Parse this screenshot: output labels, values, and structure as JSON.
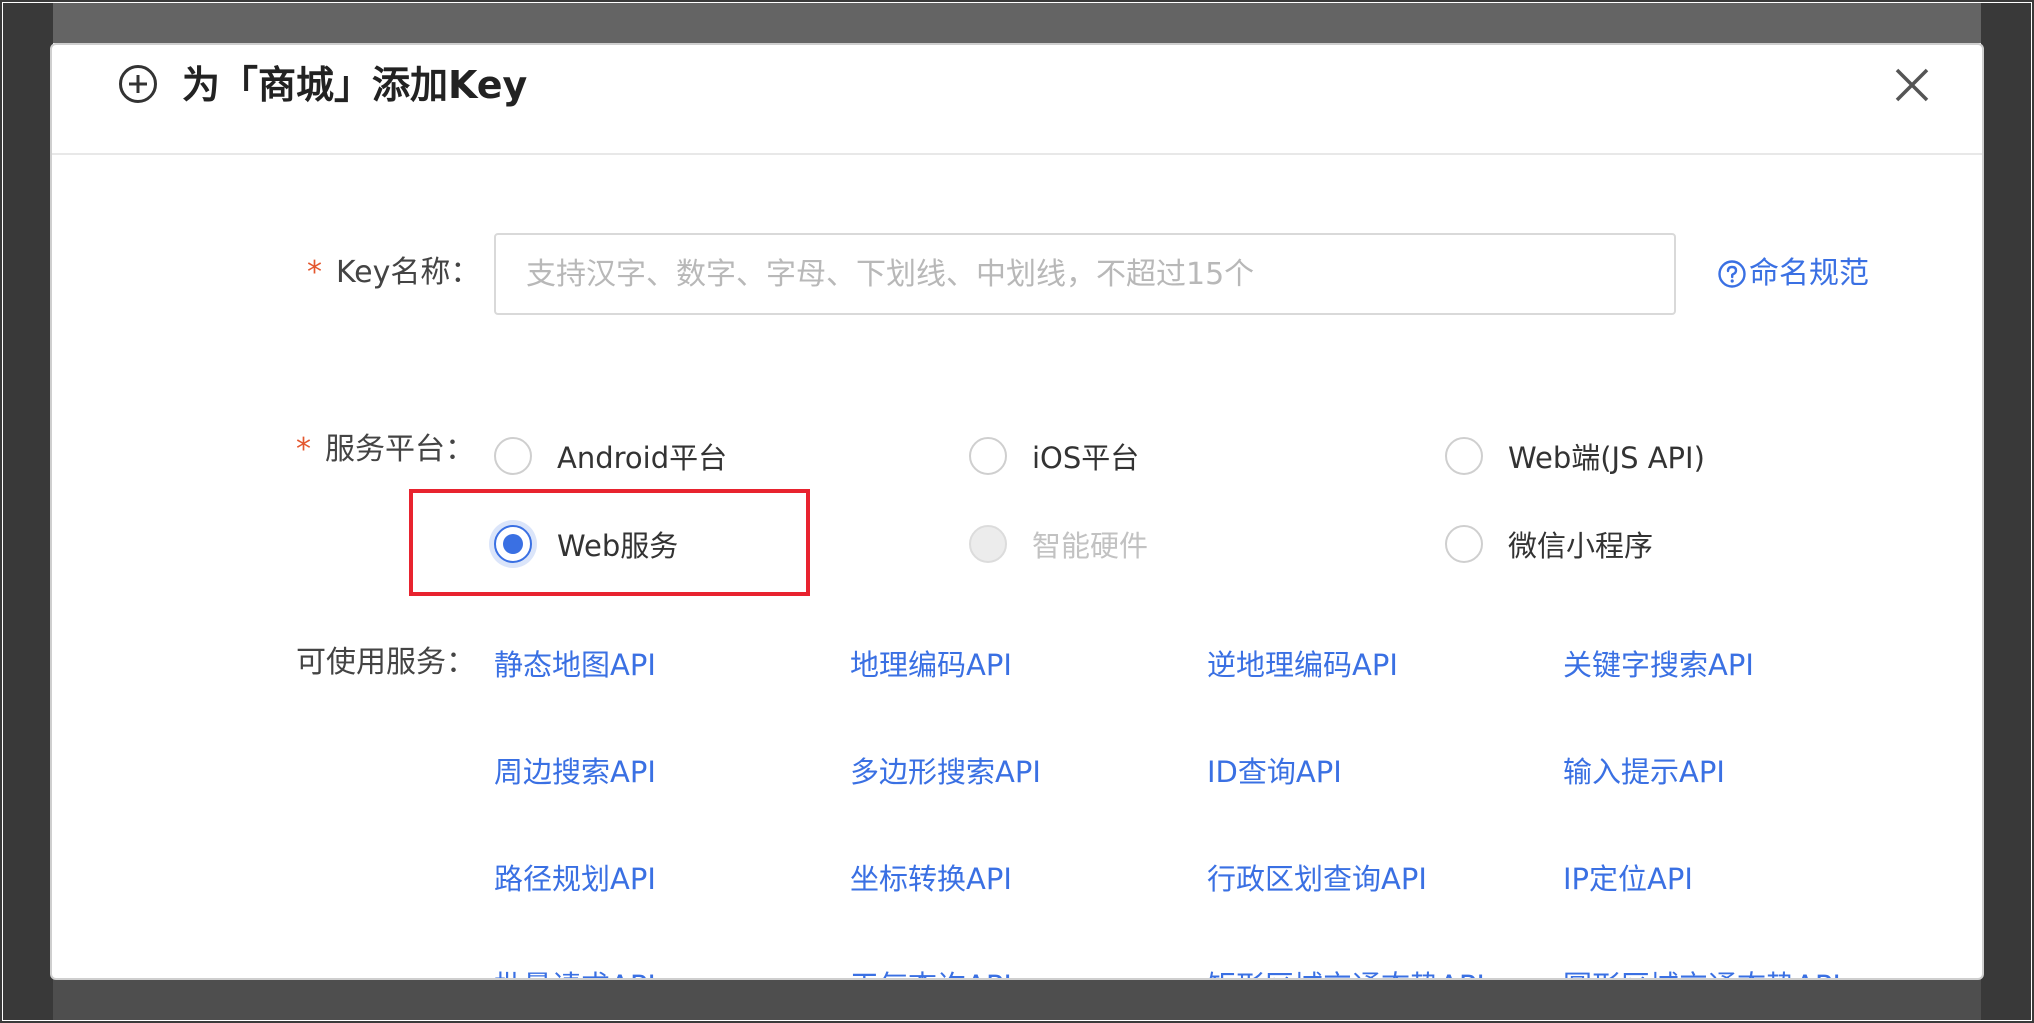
{
  "dialog": {
    "title": "为「商城」添加Key"
  },
  "form": {
    "key_name": {
      "label": "Key名称：",
      "required_mark": "*",
      "placeholder": "支持汉字、数字、字母、下划线、中划线，不超过15个",
      "value": ""
    },
    "help_link": "命名规范",
    "platform": {
      "label": "服务平台：",
      "required_mark": "*",
      "options": [
        {
          "label": "Android平台",
          "checked": false,
          "disabled": false
        },
        {
          "label": "iOS平台",
          "checked": false,
          "disabled": false
        },
        {
          "label": "Web端(JS API)",
          "checked": false,
          "disabled": false
        },
        {
          "label": "Web服务",
          "checked": true,
          "disabled": false
        },
        {
          "label": "智能硬件",
          "checked": false,
          "disabled": true
        },
        {
          "label": "微信小程序",
          "checked": false,
          "disabled": false
        }
      ]
    },
    "services": {
      "label": "可使用服务：",
      "items": [
        "静态地图API",
        "地理编码API",
        "逆地理编码API",
        "关键字搜索API",
        "周边搜索API",
        "多边形搜索API",
        "ID查询API",
        "输入提示API",
        "路径规划API",
        "坐标转换API",
        "行政区划查询API",
        "IP定位API",
        "批量请求API",
        "天气查询API",
        "矩形区域交通态势API",
        "圆形区域交通态势API"
      ]
    }
  },
  "colors": {
    "accent": "#3a70e3",
    "required": "#e4572e",
    "highlight": "#e8232f",
    "overlay": "#646464"
  },
  "icons": {
    "header": "plus-circle-icon",
    "close": "close-icon",
    "help": "question-circle-icon"
  }
}
